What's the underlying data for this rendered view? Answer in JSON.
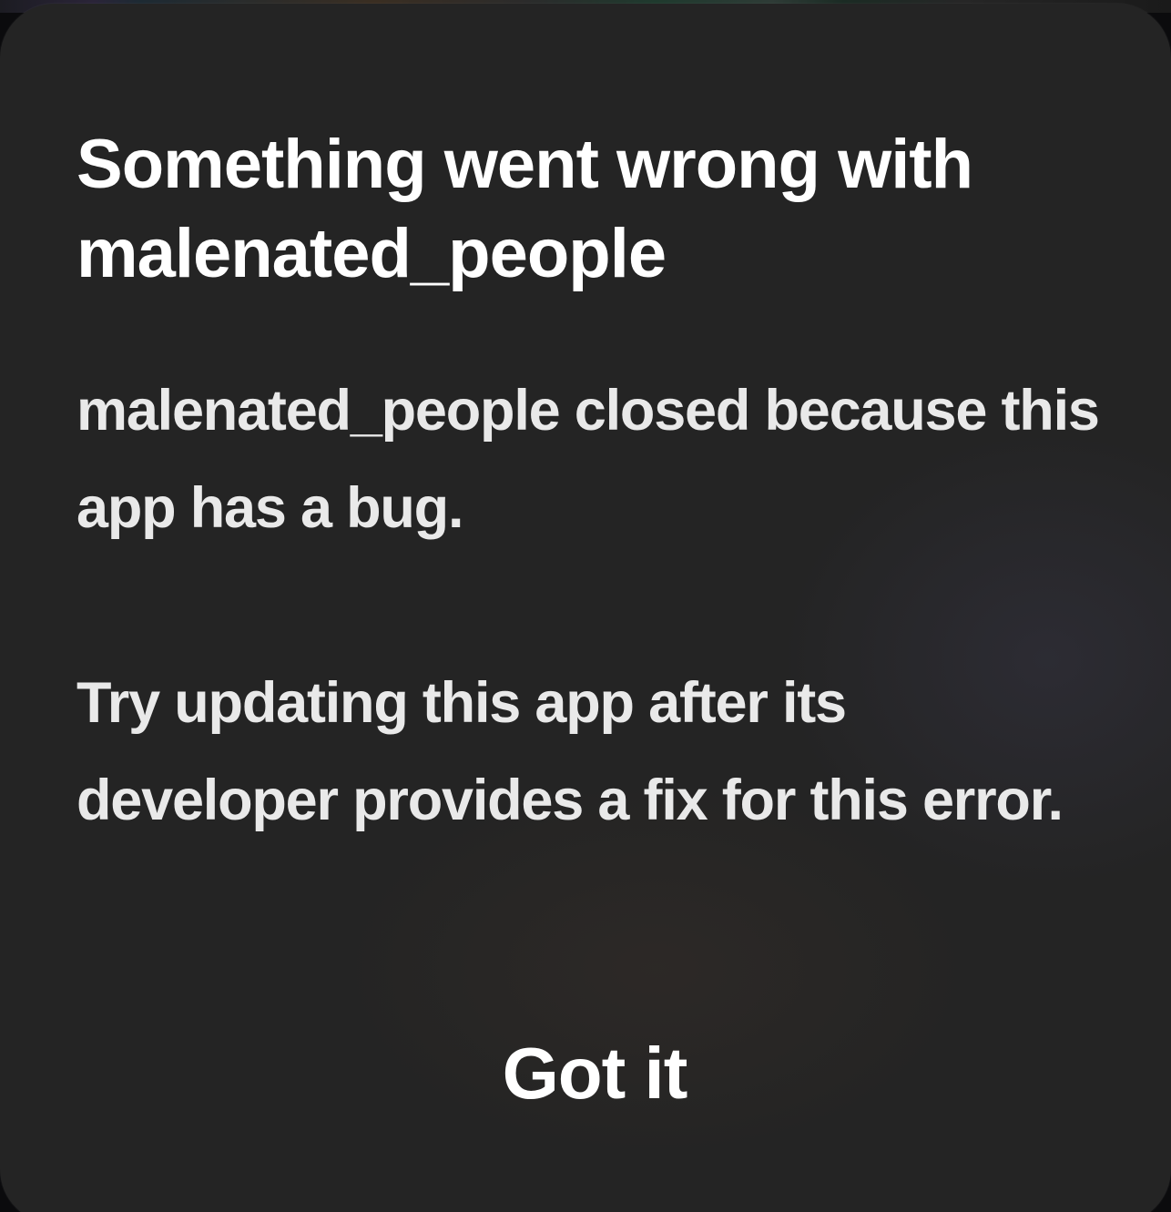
{
  "dialog": {
    "title": "Something went wrong with malenated_people",
    "message": "malenated_people closed because this app has a bug.\n\nTry updating this app after its developer provides a fix for this error.",
    "button_label": "Got it"
  },
  "colors": {
    "dialog_background": "#242424",
    "title_text": "#ffffff",
    "message_text": "#e9e9e9"
  }
}
